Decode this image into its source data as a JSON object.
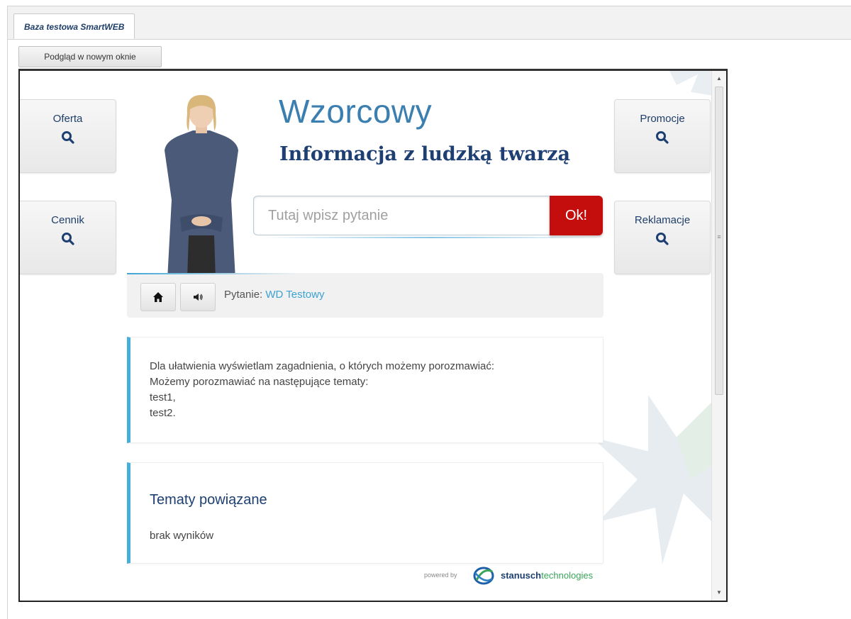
{
  "tab": {
    "label": "Baza testowa SmartWEB"
  },
  "toolbar": {
    "preview_label": "Podgląd w nowym oknie"
  },
  "tiles": {
    "offer": "Oferta",
    "prices": "Cennik",
    "promotions": "Promocje",
    "complaints": "Reklamacje"
  },
  "brand": {
    "title": "Wzorcowy",
    "subtitle": "Informacja z ludzką twarzą"
  },
  "search": {
    "placeholder": "Tutaj wpisz pytanie",
    "submit_label": "Ok!"
  },
  "question": {
    "label": "Pytanie:",
    "value": "WD Testowy"
  },
  "answer": {
    "lines": [
      "Dla ułatwienia wyświetlam zagadnienia, o których możemy porozmawiać:",
      "Możemy porozmawiać na następujące tematy:",
      "test1,",
      "test2."
    ]
  },
  "related": {
    "title": "Tematy powiązane",
    "empty": "brak wyników"
  },
  "footer": {
    "powered_by": "powered by",
    "brand_bold": "stanusch",
    "brand_light": "technologies"
  },
  "colors": {
    "accent_blue": "#47afd9",
    "ok_red": "#c40e0e",
    "title_blue": "#3b7fb0",
    "navy": "#1d3f71"
  },
  "icons": {
    "tile": "search-icon",
    "home": "home-icon",
    "sound": "speaker-icon"
  }
}
